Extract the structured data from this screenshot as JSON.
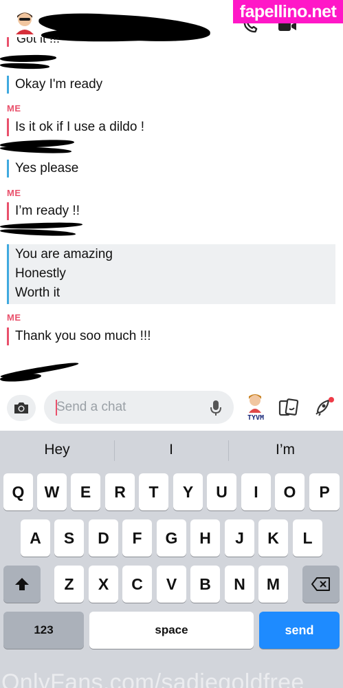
{
  "header": {
    "cutoff_text": "Got it !!!",
    "phone_icon": "phone-icon",
    "video_icon": "video-icon"
  },
  "watermark_top": "fapellino.net",
  "messages": [
    {
      "sender": "",
      "text": "Okay I'm ready",
      "color": "blue"
    },
    {
      "sender": "ME",
      "text": "Is it ok if I use a dildo !",
      "color": "red"
    },
    {
      "sender": "",
      "text": "Yes please",
      "color": "blue"
    },
    {
      "sender": "ME",
      "text": "I’m ready !!",
      "color": "red"
    }
  ],
  "saved_block": [
    "You are amazing",
    "Honestly",
    "Worth it"
  ],
  "last_message": {
    "sender": "ME",
    "text": "Thank you soo much !!!"
  },
  "chat_input": {
    "placeholder": "Send a chat"
  },
  "bitmoji_caption": "TYVM",
  "suggestions": [
    "Hey",
    "I",
    "I’m"
  ],
  "keyboard": {
    "row1": [
      "Q",
      "W",
      "E",
      "R",
      "T",
      "Y",
      "U",
      "I",
      "O",
      "P"
    ],
    "row2": [
      "A",
      "S",
      "D",
      "F",
      "G",
      "H",
      "J",
      "K",
      "L"
    ],
    "row3": [
      "Z",
      "X",
      "C",
      "V",
      "B",
      "N",
      "M"
    ],
    "numbers_label": "123",
    "space_label": "space",
    "send_label": "send"
  },
  "watermark_bottom": "OnlyFans.com/sadiegoldfree",
  "colors": {
    "accent_red": "#e9506b",
    "accent_blue": "#3fa9df",
    "send_blue": "#1e8bff",
    "watermark_pink": "#ff17c7"
  }
}
